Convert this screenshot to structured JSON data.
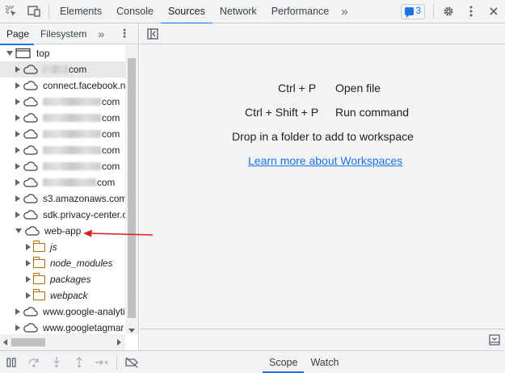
{
  "toolbar": {
    "inspect_icon": "inspect-element-icon",
    "device_icon": "device-toolbar-icon",
    "tabs": [
      {
        "label": "Elements"
      },
      {
        "label": "Console"
      },
      {
        "label": "Sources",
        "active": true
      },
      {
        "label": "Network"
      },
      {
        "label": "Performance"
      }
    ],
    "more_tabs": "»",
    "issues_count": "3",
    "settings_icon": "gear-icon",
    "menu_icon": "kebab-menu-icon",
    "close_icon": "close-icon"
  },
  "navigator": {
    "tabs": [
      {
        "label": "Page",
        "active": true
      },
      {
        "label": "Filesystem"
      }
    ],
    "more": "»",
    "tree": [
      {
        "label": "top",
        "level": 0,
        "type": "frame",
        "expanded": true
      },
      {
        "label": "com",
        "level": 1,
        "type": "domain",
        "blurred_prefix": true,
        "selected": true
      },
      {
        "label": "connect.facebook.ne",
        "level": 1,
        "type": "domain"
      },
      {
        "label": "com",
        "level": 1,
        "type": "domain",
        "blurred_prefix": true
      },
      {
        "label": "com",
        "level": 1,
        "type": "domain",
        "blurred_prefix": true
      },
      {
        "label": "com",
        "level": 1,
        "type": "domain",
        "blurred_prefix": true
      },
      {
        "label": "com",
        "level": 1,
        "type": "domain",
        "blurred_prefix": true
      },
      {
        "label": "com",
        "level": 1,
        "type": "domain",
        "blurred_prefix": true
      },
      {
        "label": "com",
        "level": 1,
        "type": "domain",
        "blurred_prefix": true
      },
      {
        "label": "s3.amazonaws.com",
        "level": 1,
        "type": "domain"
      },
      {
        "label": "sdk.privacy-center.c",
        "level": 1,
        "type": "domain"
      },
      {
        "label": "web-app",
        "level": 1,
        "type": "domain",
        "expanded": true
      },
      {
        "label": "js",
        "level": 2,
        "type": "folder"
      },
      {
        "label": "node_modules",
        "level": 2,
        "type": "folder"
      },
      {
        "label": "packages",
        "level": 2,
        "type": "folder"
      },
      {
        "label": "webpack",
        "level": 2,
        "type": "folder"
      },
      {
        "label": "www.google-analyti",
        "level": 1,
        "type": "domain"
      },
      {
        "label": "www.googletagmar",
        "level": 1,
        "type": "domain"
      }
    ]
  },
  "editor": {
    "shortcuts": [
      {
        "keys": "Ctrl + P",
        "action": "Open file"
      },
      {
        "keys": "Ctrl + Shift + P",
        "action": "Run command"
      }
    ],
    "drop_hint": "Drop in a folder to add to workspace",
    "learn_more": "Learn more about Workspaces"
  },
  "debugger": {
    "tabs": [
      {
        "label": "Scope",
        "active": true
      },
      {
        "label": "Watch"
      }
    ]
  },
  "colors": {
    "accent": "#1a73e8",
    "folder": "#b06d12",
    "annotation": "#e02020"
  }
}
